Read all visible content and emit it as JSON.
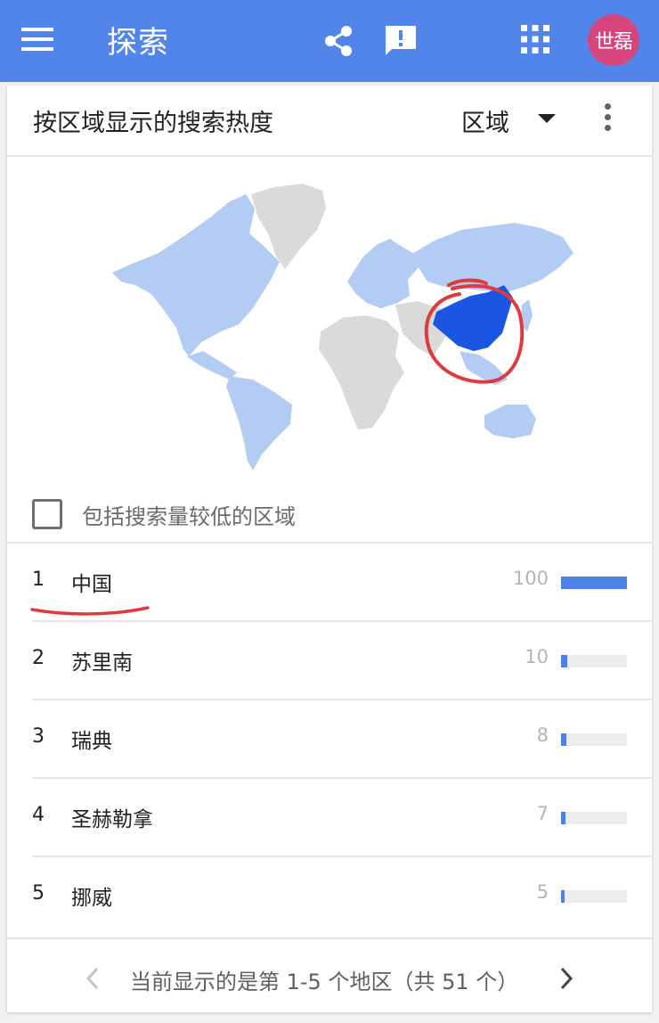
{
  "header": {
    "title": "探索",
    "avatar_text": "世磊",
    "icons": [
      "menu-icon",
      "share-icon",
      "feedback-icon",
      "apps-icon"
    ]
  },
  "card": {
    "title": "按区域显示的搜索热度",
    "region_select": "区域",
    "include_low_volume_label": "包括搜索量较低的区域",
    "include_low_volume_checked": false
  },
  "rows": [
    {
      "rank": "1",
      "name": "中国",
      "value": "100",
      "fill_percent": 100
    },
    {
      "rank": "2",
      "name": "苏里南",
      "value": "10",
      "fill_percent": 10
    },
    {
      "rank": "3",
      "name": "瑞典",
      "value": "8",
      "fill_percent": 8
    },
    {
      "rank": "4",
      "name": "圣赫勒拿",
      "value": "7",
      "fill_percent": 7
    },
    {
      "rank": "5",
      "name": "挪威",
      "value": "5",
      "fill_percent": 5
    }
  ],
  "pager": {
    "text": "当前显示的是第 1-5 个地区（共 51 个）"
  },
  "colors": {
    "header": "#5285e9",
    "bar_fill": "#4c81e8",
    "map_high": "#1a55e3",
    "map_low": "#b3ccf4",
    "map_none": "#dadada",
    "annotation": "#e0393e",
    "avatar": "#d6467c"
  }
}
